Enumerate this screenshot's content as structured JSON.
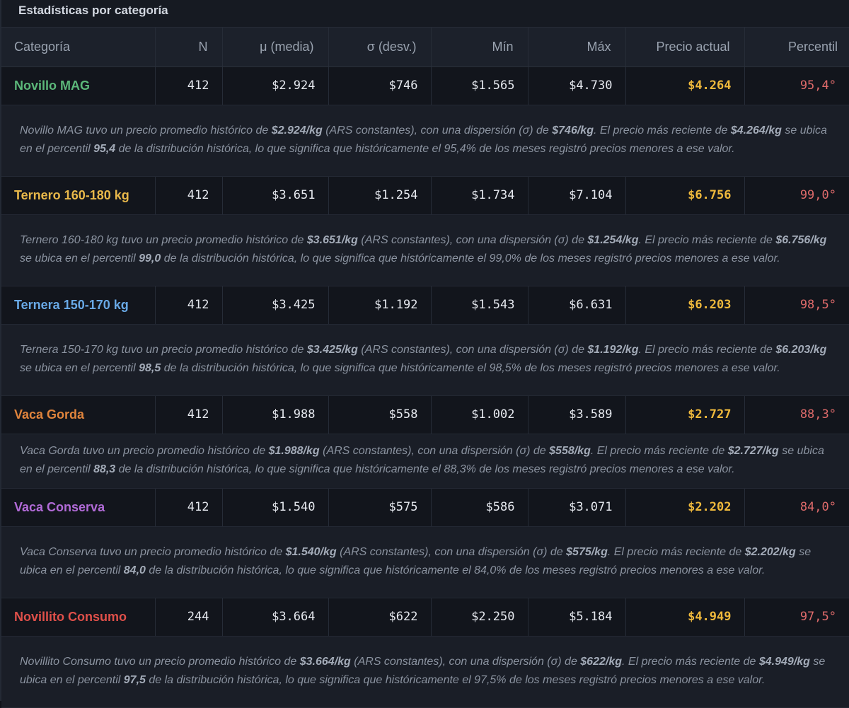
{
  "panel": {
    "title": "Estadísticas por categoría"
  },
  "columns": [
    "Categoría",
    "N",
    "μ (media)",
    "σ (desv.)",
    "Mín",
    "Máx",
    "Precio actual",
    "Percentil"
  ],
  "rows": [
    {
      "name": "Novillo MAG",
      "color": "#5cb87a",
      "n": "412",
      "mean": "$2.924",
      "sd": "$746",
      "min": "$1.565",
      "max": "$4.730",
      "current": "$4.264",
      "percentile": "95,4°",
      "desc": [
        "Novillo MAG tuvo un precio promedio histórico de ",
        "$2.924/kg",
        " (ARS constantes), con una dispersión (σ) de ",
        "$746/kg",
        ". El precio más reciente de ",
        "$4.264/kg",
        " se ubica en el percentil ",
        "95,4",
        " de la distribución histórica, lo que significa que históricamente el 95,4% de los meses registró precios menores a ese valor."
      ]
    },
    {
      "name": "Ternero 160-180 kg",
      "color": "#e8b84a",
      "n": "412",
      "mean": "$3.651",
      "sd": "$1.254",
      "min": "$1.734",
      "max": "$7.104",
      "current": "$6.756",
      "percentile": "99,0°",
      "desc": [
        "Ternero 160-180 kg tuvo un precio promedio histórico de ",
        "$3.651/kg",
        " (ARS constantes), con una dispersión (σ) de ",
        "$1.254/kg",
        ". El precio más reciente de ",
        "$6.756/kg",
        " se ubica en el percentil ",
        "99,0",
        " de la distribución histórica, lo que significa que históricamente el 99,0% de los meses registró precios menores a ese valor."
      ]
    },
    {
      "name": "Ternera 150-170 kg",
      "color": "#69a9e6",
      "n": "412",
      "mean": "$3.425",
      "sd": "$1.192",
      "min": "$1.543",
      "max": "$6.631",
      "current": "$6.203",
      "percentile": "98,5°",
      "desc": [
        "Ternera 150-170 kg tuvo un precio promedio histórico de ",
        "$3.425/kg",
        " (ARS constantes), con una dispersión (σ) de ",
        "$1.192/kg",
        ". El precio más reciente de ",
        "$6.203/kg",
        " se ubica en el percentil ",
        "98,5",
        " de la distribución histórica, lo que significa que históricamente el 98,5% de los meses registró precios menores a ese valor."
      ]
    },
    {
      "name": "Vaca Gorda",
      "color": "#e0843c",
      "n": "412",
      "mean": "$1.988",
      "sd": "$558",
      "min": "$1.002",
      "max": "$3.589",
      "current": "$2.727",
      "percentile": "88,3°",
      "desc": [
        "Vaca Gorda tuvo un precio promedio histórico de ",
        "$1.988/kg",
        " (ARS constantes), con una dispersión (σ) de ",
        "$558/kg",
        ". El precio más reciente de ",
        "$2.727/kg",
        " se ubica en el percentil ",
        "88,3",
        " de la distribución histórica, lo que significa que históricamente el 88,3% de los meses registró precios menores a ese valor."
      ]
    },
    {
      "name": "Vaca Conserva",
      "color": "#b26bd8",
      "n": "412",
      "mean": "$1.540",
      "sd": "$575",
      "min": "$586",
      "max": "$3.071",
      "current": "$2.202",
      "percentile": "84,0°",
      "desc": [
        "Vaca Conserva tuvo un precio promedio histórico de ",
        "$1.540/kg",
        " (ARS constantes), con una dispersión (σ) de ",
        "$575/kg",
        ". El precio más reciente de ",
        "$2.202/kg",
        " se ubica en el percentil ",
        "84,0",
        " de la distribución histórica, lo que significa que históricamente el 84,0% de los meses registró precios menores a ese valor."
      ]
    },
    {
      "name": "Novillito Consumo",
      "color": "#e0504a",
      "n": "244",
      "mean": "$3.664",
      "sd": "$622",
      "min": "$2.250",
      "max": "$5.184",
      "current": "$4.949",
      "percentile": "97,5°",
      "desc": [
        "Novillito Consumo tuvo un precio promedio histórico de ",
        "$3.664/kg",
        " (ARS constantes), con una dispersión (σ) de ",
        "$622/kg",
        ". El precio más reciente de ",
        "$4.949/kg",
        " se ubica en el percentil ",
        "97,5",
        " de la distribución histórica, lo que significa que históricamente el 97,5% de los meses registró precios menores a ese valor."
      ]
    }
  ]
}
